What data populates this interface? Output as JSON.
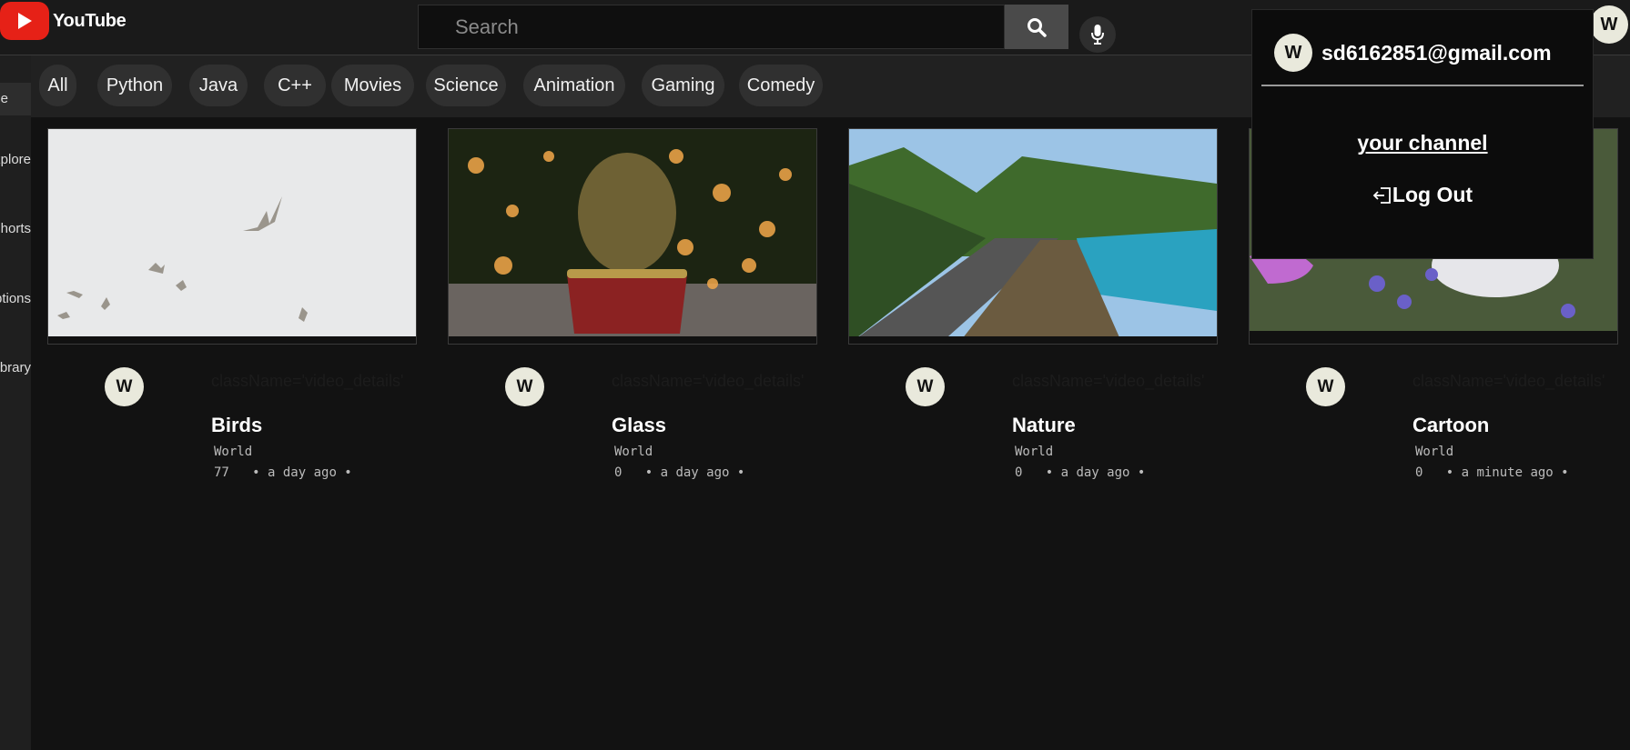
{
  "header": {
    "logo_text": "YouTube",
    "search_placeholder": "Search",
    "avatar_initial": "W"
  },
  "sidebar": {
    "items": [
      {
        "label": "Home"
      },
      {
        "label": "Explore"
      },
      {
        "label": "Shorts"
      },
      {
        "label": "Subscriptions"
      },
      {
        "label": "Library"
      }
    ]
  },
  "chips": [
    "All",
    "Python",
    "Java",
    "C++",
    "Movies",
    "Science",
    "Animation",
    "Gaming",
    "Comedy"
  ],
  "videos": [
    {
      "title": "Birds",
      "channel": "World",
      "views": "77",
      "time": "a day ago",
      "debug": "className='video_details'",
      "avatar": "W"
    },
    {
      "title": "Glass",
      "channel": "World",
      "views": "0",
      "time": "a day ago",
      "debug": "className='video_details'",
      "avatar": "W"
    },
    {
      "title": "Nature",
      "channel": "World",
      "views": "0",
      "time": "a day ago",
      "debug": "className='video_details'",
      "avatar": "W"
    },
    {
      "title": "Cartoon",
      "channel": "World",
      "views": "0",
      "time": "a minute ago",
      "debug": "className='video_details'",
      "avatar": "W"
    }
  ],
  "dropdown": {
    "avatar_initial": "W",
    "email": "sd6162851@gmail.com",
    "channel_link": "your channel",
    "logout_label": "Log Out"
  },
  "colors": {
    "background": "#121212",
    "accent": "#e62117",
    "chip": "#303030"
  }
}
